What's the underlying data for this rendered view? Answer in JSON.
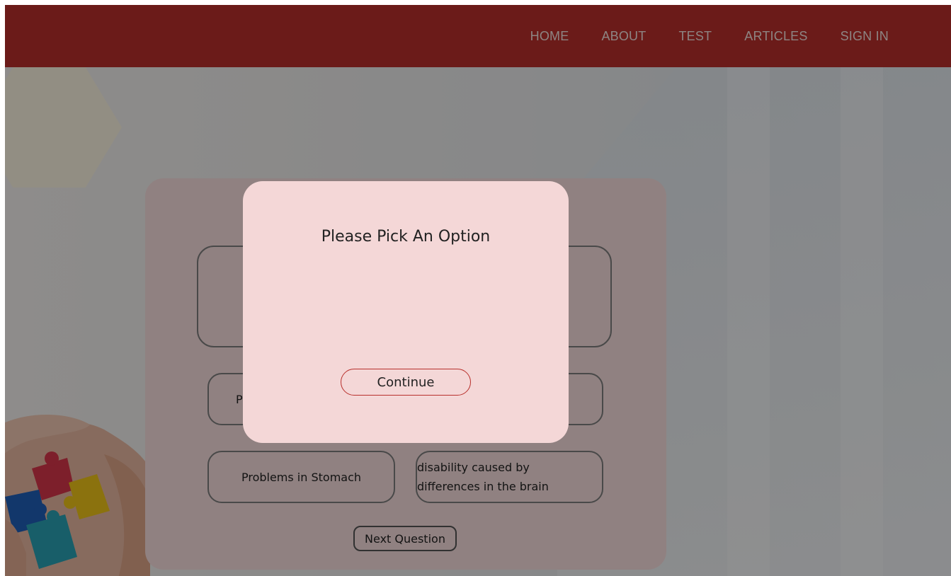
{
  "nav": {
    "items": [
      {
        "label": "HOME"
      },
      {
        "label": "ABOUT"
      },
      {
        "label": "TEST"
      },
      {
        "label": "ARTICLES"
      },
      {
        "label": "SIGN IN"
      }
    ]
  },
  "quiz": {
    "option_a_partial": "P",
    "option_c": "Problems in Stomach",
    "option_d": "disability caused by differences in the brain",
    "next_label": "Next Question"
  },
  "modal": {
    "title": "Please Pick An Option",
    "continue_label": "Continue"
  },
  "colors": {
    "navbar": "#b8302c",
    "card": "#f9dfde",
    "modal": "#f4d7d7",
    "accent_border": "#b8302c"
  },
  "icons": {
    "decoration": "puzzle-hands-image"
  }
}
